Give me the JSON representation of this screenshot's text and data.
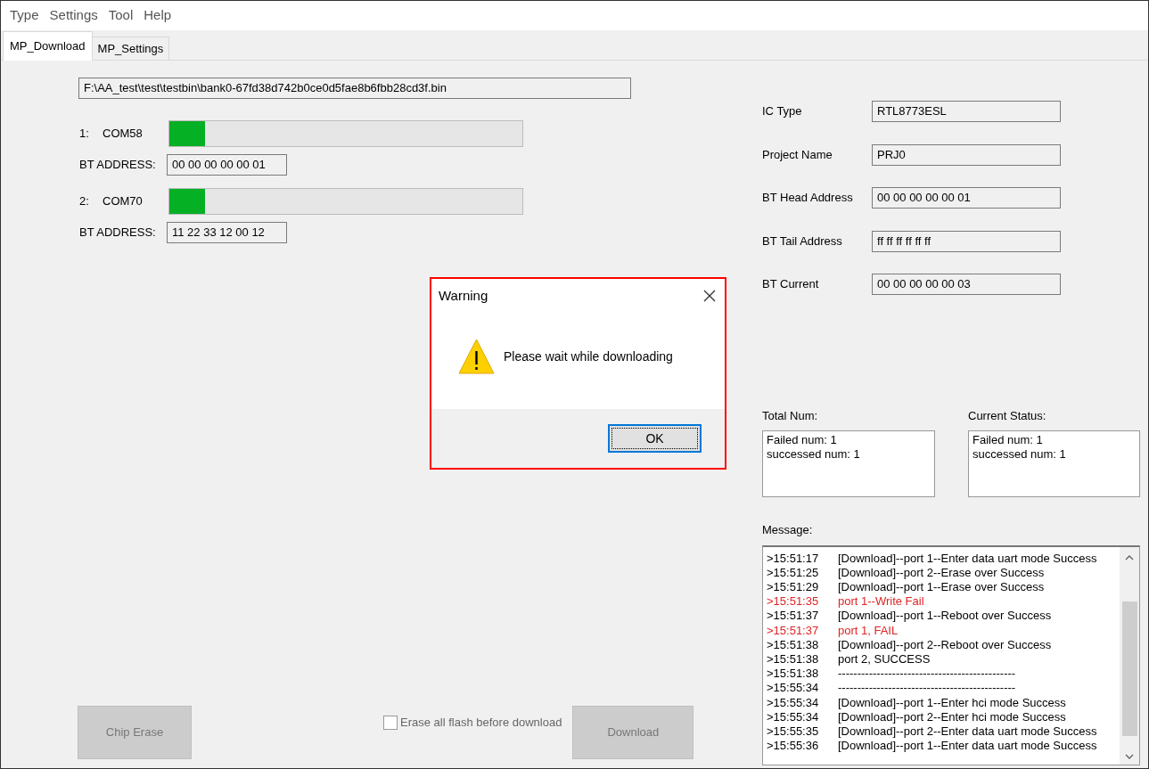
{
  "menu": [
    "Type",
    "Settings",
    "Tool",
    "Help"
  ],
  "tabs": [
    {
      "label": "MP_Download",
      "selected": true
    },
    {
      "label": "MP_Settings",
      "selected": false
    }
  ],
  "file_path": "F:\\AA_test\\test\\testbin\\bank0-67fd38d742b0ce0d5fae8b6fbb28cd3f.bin",
  "ports": [
    {
      "index": "1:",
      "name": "COM58",
      "level": 0.1,
      "address_label": "BT ADDRESS:",
      "address": "00 00 00 00 00 01"
    },
    {
      "index": "2:",
      "name": "COM70",
      "level": 0.1,
      "address_label": "BT ADDRESS:",
      "address": "11 22 33 12 00 12"
    }
  ],
  "chip_erase_button": {
    "label": "Chip Erase",
    "disabled": true
  },
  "erase_all_checkbox": {
    "label": "Erase all flash before download",
    "checked": false
  },
  "download_button": {
    "label": "Download",
    "disabled": true
  },
  "info_fields": [
    {
      "label": "IC Type",
      "value": "RTL8773ESL"
    },
    {
      "label": "Project Name",
      "value": "PRJ0"
    },
    {
      "label": "BT Head Address",
      "value": "00 00 00 00 00 01"
    },
    {
      "label": "BT Tail Address",
      "value": "ff ff ff ff ff ff"
    },
    {
      "label": "BT Current",
      "value": "00 00 00 00 00 03"
    }
  ],
  "total_num": {
    "label": "Total Num:",
    "lines": [
      "Failed num: 1",
      "successed num: 1"
    ]
  },
  "current_status": {
    "label": "Current Status:",
    "lines": [
      "Failed num: 1",
      "successed num: 1"
    ]
  },
  "message": {
    "label": "Message:",
    "entries": [
      {
        "time": ">15:51:17",
        "text": "[Download]--port 1--Enter data uart mode Success",
        "kind": "info"
      },
      {
        "time": ">15:51:25",
        "text": "[Download]--port 2--Erase over Success",
        "kind": "info"
      },
      {
        "time": ">15:51:29",
        "text": "[Download]--port 1--Erase over Success",
        "kind": "info"
      },
      {
        "time": ">15:51:35",
        "text": "port 1--Write Fail",
        "kind": "error"
      },
      {
        "time": ">15:51:37",
        "text": "[Download]--port 1--Reboot over Success",
        "kind": "info"
      },
      {
        "time": ">15:51:37",
        "text": "port 1, FAIL",
        "kind": "error"
      },
      {
        "time": ">15:51:38",
        "text": "[Download]--port 2--Reboot over Success",
        "kind": "info"
      },
      {
        "time": ">15:51:38",
        "text": "port 2, SUCCESS",
        "kind": "info"
      },
      {
        "time": ">15:51:38",
        "text": "----------------------------------------------",
        "kind": "info"
      },
      {
        "time": ">15:55:34",
        "text": "----------------------------------------------",
        "kind": "info"
      },
      {
        "time": ">15:55:34",
        "text": "[Download]--port 1--Enter hci mode Success",
        "kind": "info"
      },
      {
        "time": ">15:55:34",
        "text": "[Download]--port 2--Enter hci mode Success",
        "kind": "info"
      },
      {
        "time": ">15:55:35",
        "text": "[Download]--port 2--Enter data uart mode Success",
        "kind": "info"
      },
      {
        "time": ">15:55:36",
        "text": "[Download]--port 1--Enter data uart mode Success",
        "kind": "info"
      }
    ]
  },
  "dialog": {
    "title": "Warning",
    "text": "Please wait while downloading",
    "button": "OK"
  }
}
